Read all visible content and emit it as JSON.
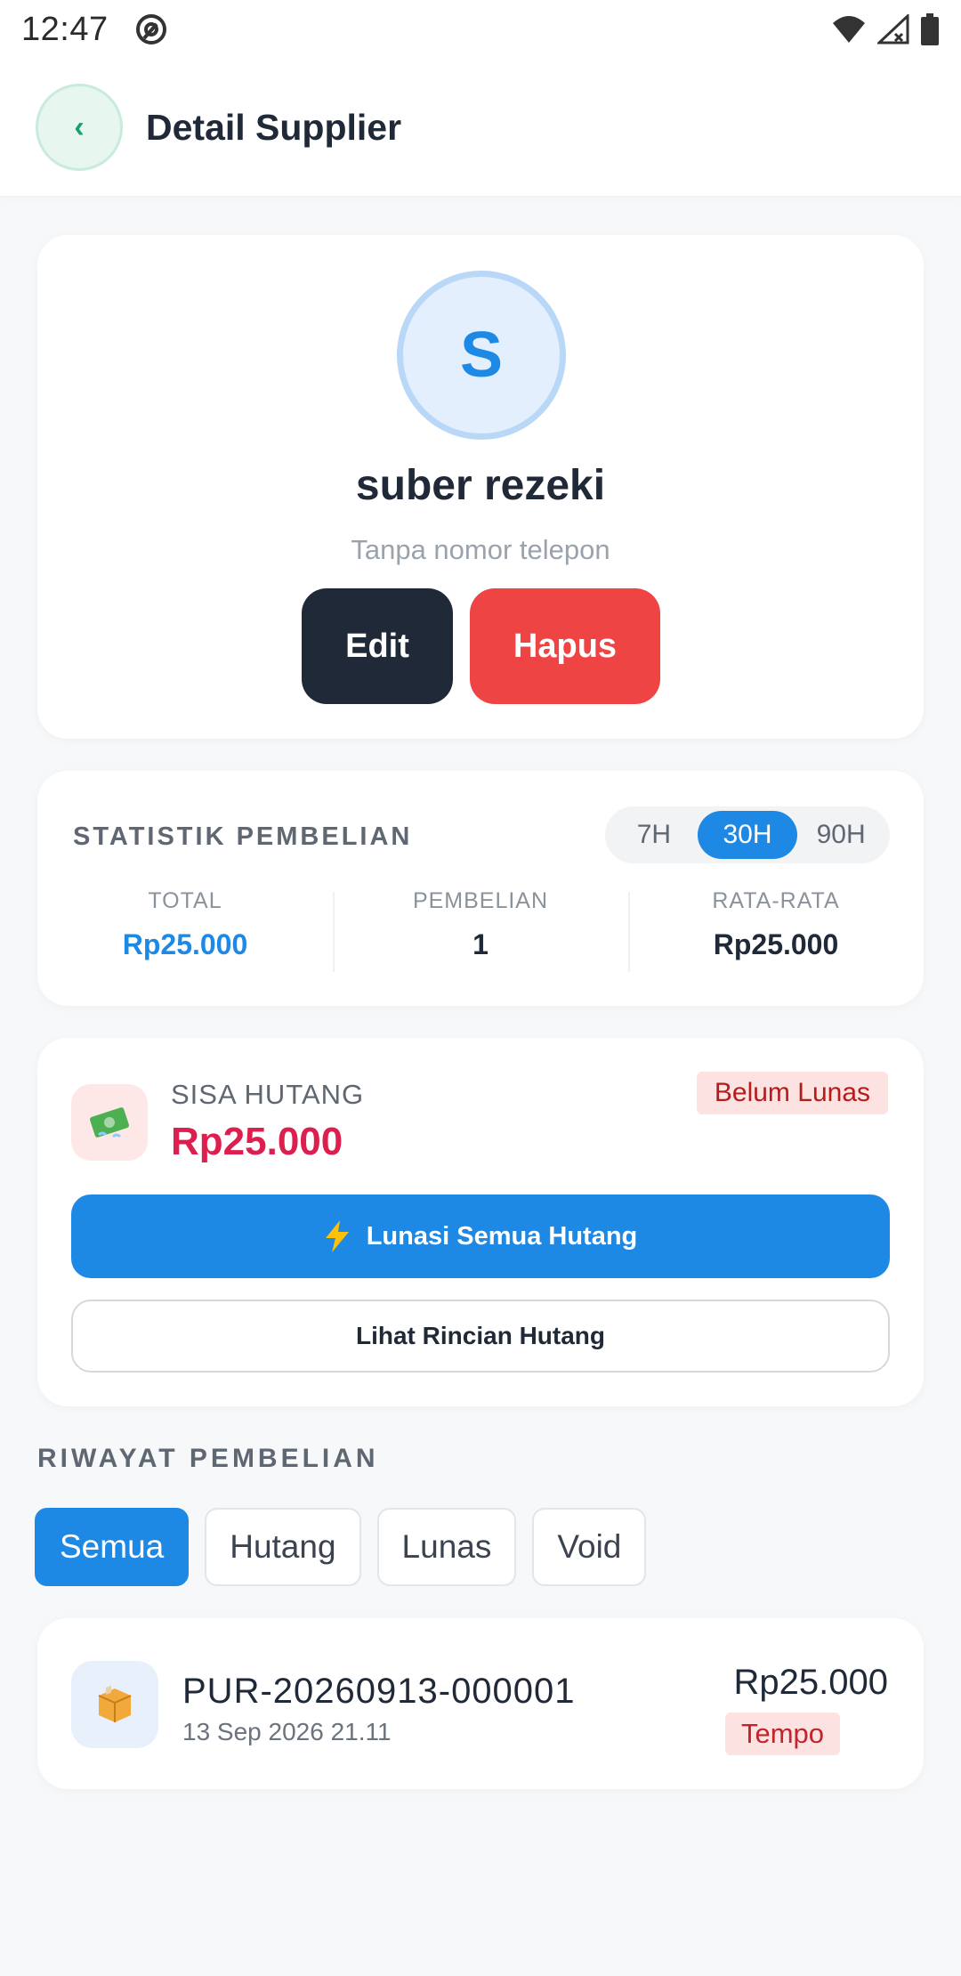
{
  "statusbar": {
    "time": "12:47"
  },
  "appbar": {
    "back_glyph": "‹",
    "title": "Detail Supplier"
  },
  "profile": {
    "avatar_letter": "S",
    "name": "suber rezeki",
    "phone": "Tanpa nomor telepon",
    "edit_label": "Edit",
    "delete_label": "Hapus"
  },
  "stats": {
    "title": "STATISTIK PEMBELIAN",
    "periods": [
      "7H",
      "30H",
      "90H"
    ],
    "active_period": "30H",
    "total_label": "TOTAL",
    "total_value": "Rp25.000",
    "count_label": "PEMBELIAN",
    "count_value": "1",
    "avg_label": "RATA-RATA",
    "avg_value": "Rp25.000"
  },
  "hutang": {
    "label": "SISA HUTANG",
    "value": "Rp25.000",
    "status": "Belum Lunas",
    "pay_all_label": "Lunasi Semua Hutang",
    "detail_label": "Lihat Rincian Hutang"
  },
  "riwayat": {
    "title": "RIWAYAT PEMBELIAN",
    "filters": [
      "Semua",
      "Hutang",
      "Lunas",
      "Void"
    ],
    "active_filter": "Semua",
    "items": [
      {
        "code": "PUR-20260913-000001",
        "date": "13 Sep 2026 21.11",
        "amount": "Rp25.000",
        "status": "Tempo"
      }
    ]
  },
  "colors": {
    "primary": "#1e88e5",
    "dark": "#1f2937",
    "danger": "#ef4444",
    "debt": "#dc1f4e",
    "back_accent": "#16a074"
  }
}
